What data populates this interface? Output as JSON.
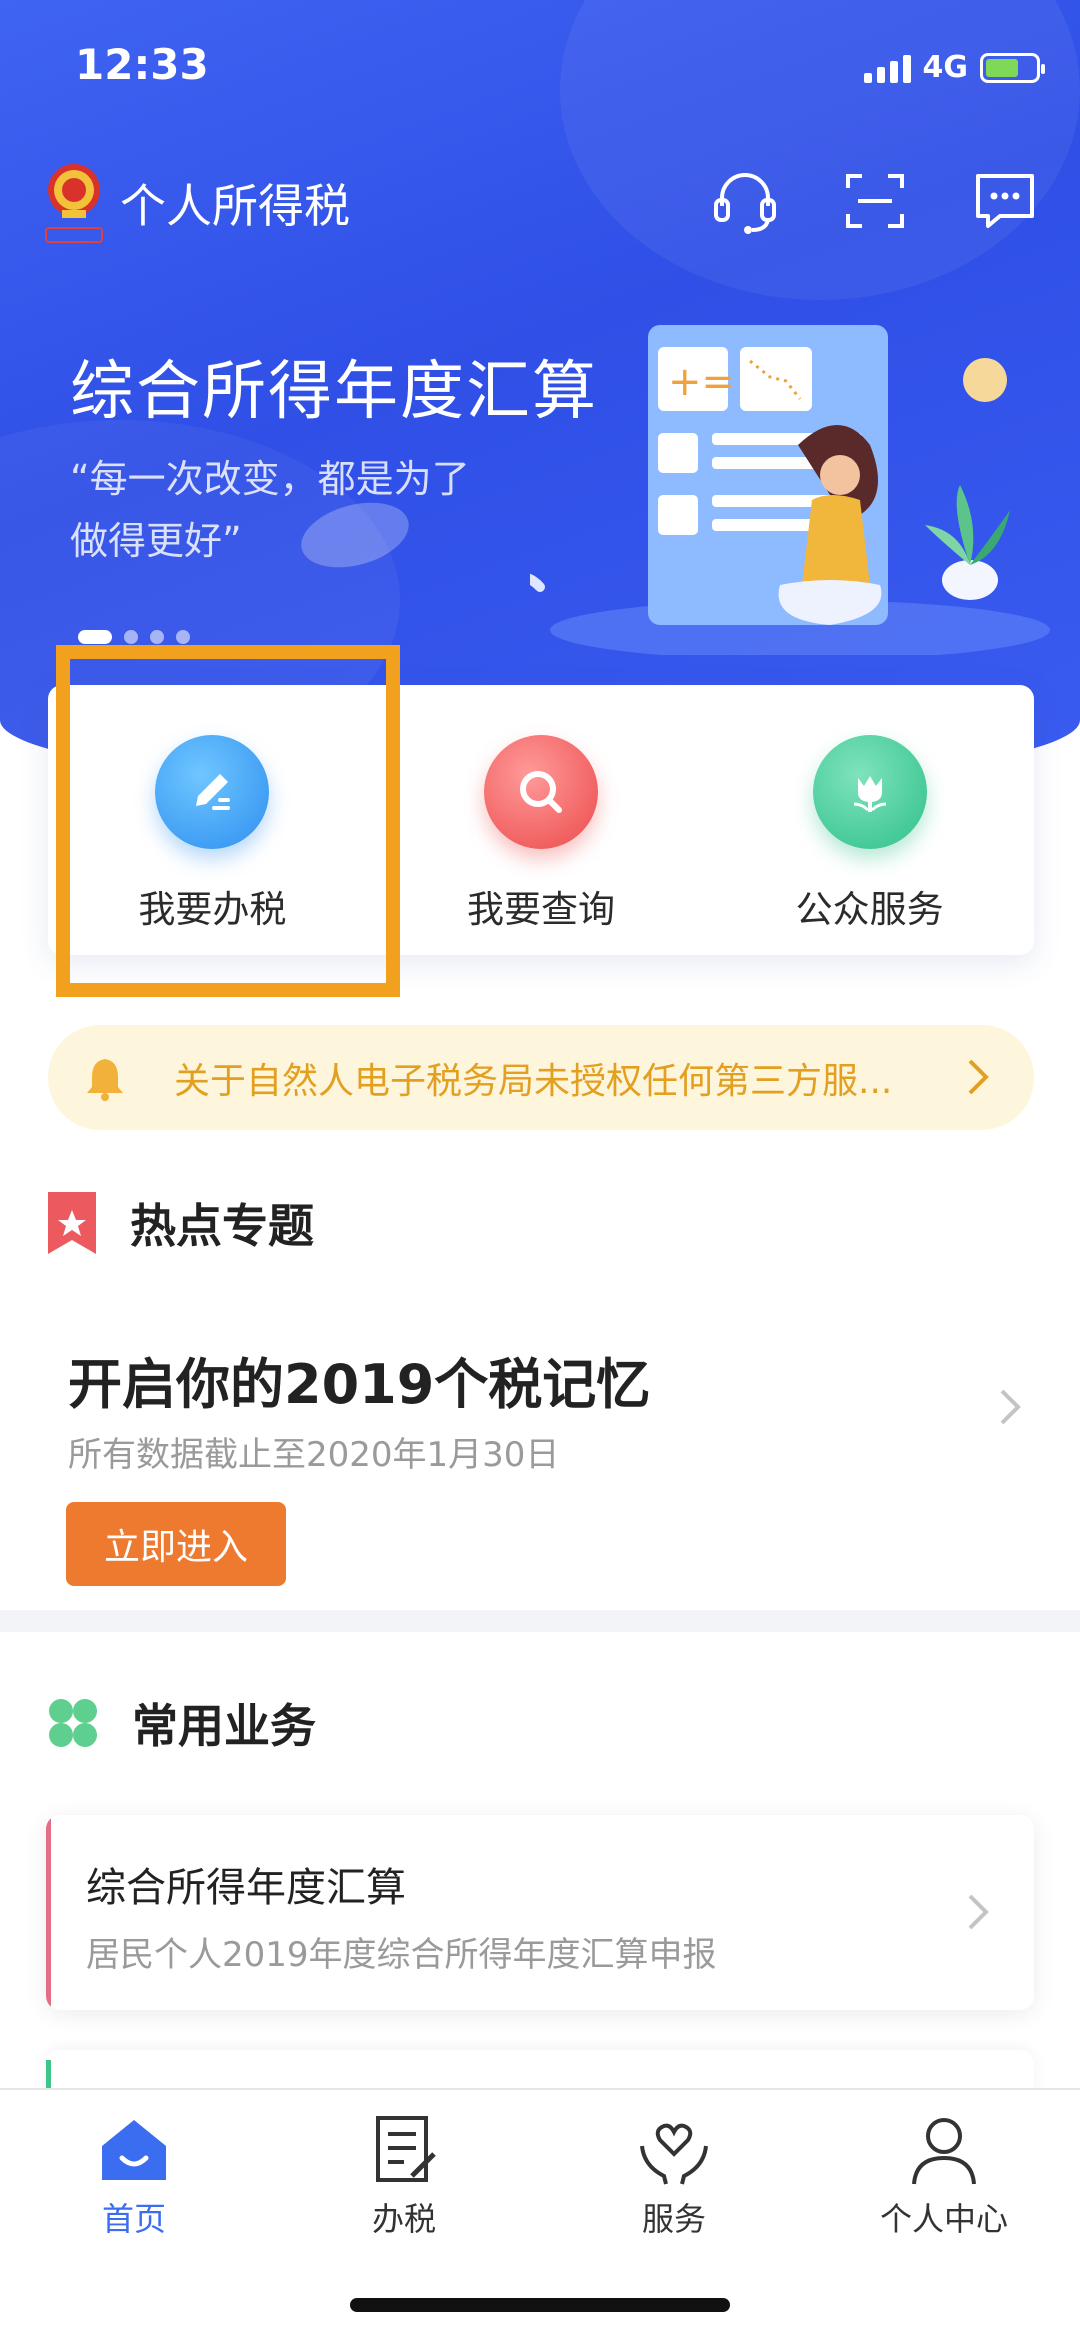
{
  "status_bar": {
    "time": "12:33",
    "network": "4G"
  },
  "app": {
    "title": "个人所得税"
  },
  "banner": {
    "title": "综合所得年度汇算",
    "quote_line1": "“每一次改变，都是为了",
    "quote_line2": "做得更好”",
    "page_count": 4,
    "active_page": 1
  },
  "quick_actions": [
    {
      "label": "我要办税",
      "icon": "pencil-icon"
    },
    {
      "label": "我要查询",
      "icon": "search-icon"
    },
    {
      "label": "公众服务",
      "icon": "tulip-icon"
    }
  ],
  "notice": {
    "text": "关于自然人电子税务局未授权任何第三方服...",
    "icon": "bell-icon"
  },
  "hot_topics": {
    "section_title": "热点专题",
    "topic_title": "开启你的2019个税记忆",
    "topic_subtitle": "所有数据截止至2020年1月30日",
    "button": "立即进入"
  },
  "common_business": {
    "section_title": "常用业务",
    "items": [
      {
        "title": "综合所得年度汇算",
        "subtitle": "居民个人2019年度综合所得年度汇算申报"
      }
    ]
  },
  "tabbar": [
    {
      "label": "首页",
      "icon": "home-icon",
      "active": true
    },
    {
      "label": "办税",
      "icon": "document-icon",
      "active": false
    },
    {
      "label": "服务",
      "icon": "heart-hands-icon",
      "active": false
    },
    {
      "label": "个人中心",
      "icon": "person-icon",
      "active": false
    }
  ],
  "colors": {
    "hero_blue": "#3a5cf0",
    "highlight_orange": "#f2a11f",
    "notice_bg": "#fdf6dd",
    "notice_text": "#e3a020",
    "button_orange": "#ee7a2f",
    "tab_active": "#3a6df0"
  }
}
